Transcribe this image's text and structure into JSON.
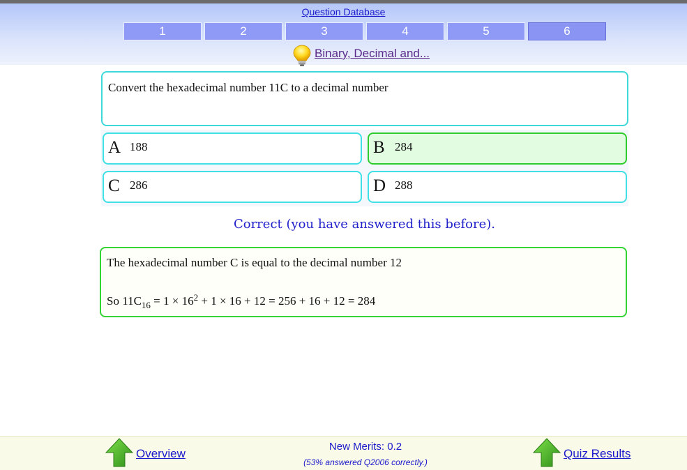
{
  "header": {
    "database_link": "Question Database",
    "tabs": [
      {
        "label": "1"
      },
      {
        "label": "2"
      },
      {
        "label": "3"
      },
      {
        "label": "4"
      },
      {
        "label": "5"
      },
      {
        "label": "6"
      }
    ],
    "active_tab": "6",
    "topic_icon": "lightbulb-icon",
    "topic_link": "Binary, Decimal and..."
  },
  "question": {
    "text": "Convert the hexadecimal number 11C to a decimal number"
  },
  "answers": [
    {
      "letter": "A",
      "value": "188"
    },
    {
      "letter": "B",
      "value": "284",
      "selected_correct": true
    },
    {
      "letter": "C",
      "value": "286"
    },
    {
      "letter": "D",
      "value": "288"
    }
  ],
  "feedback": {
    "text": "Correct (you have answered this before)."
  },
  "explanation": {
    "line1": "The hexadecimal number C is equal to the decimal number 12",
    "line2_prefix": "So 11C",
    "line2_subscript": "16",
    "line2_mid": " = 1 × 16",
    "line2_superscript": "2",
    "line2_suffix": " + 1 × 16 + 12 = 256 + 16 + 12 = 284"
  },
  "footer": {
    "left_icon": "up-arrow-icon",
    "overview_link": "Overview",
    "merits": "New Merits: 0.2",
    "percent": "(53% answered Q2006 correctly.)",
    "right_icon": "up-arrow-icon",
    "results_link": "Quiz Results"
  },
  "colors": {
    "tab_fill": "#8f99f6",
    "correct_border": "#2ecc2e",
    "correct_fill": "#e2fce2",
    "answer_border": "#3fe0e6",
    "link": "#1a1acc"
  }
}
